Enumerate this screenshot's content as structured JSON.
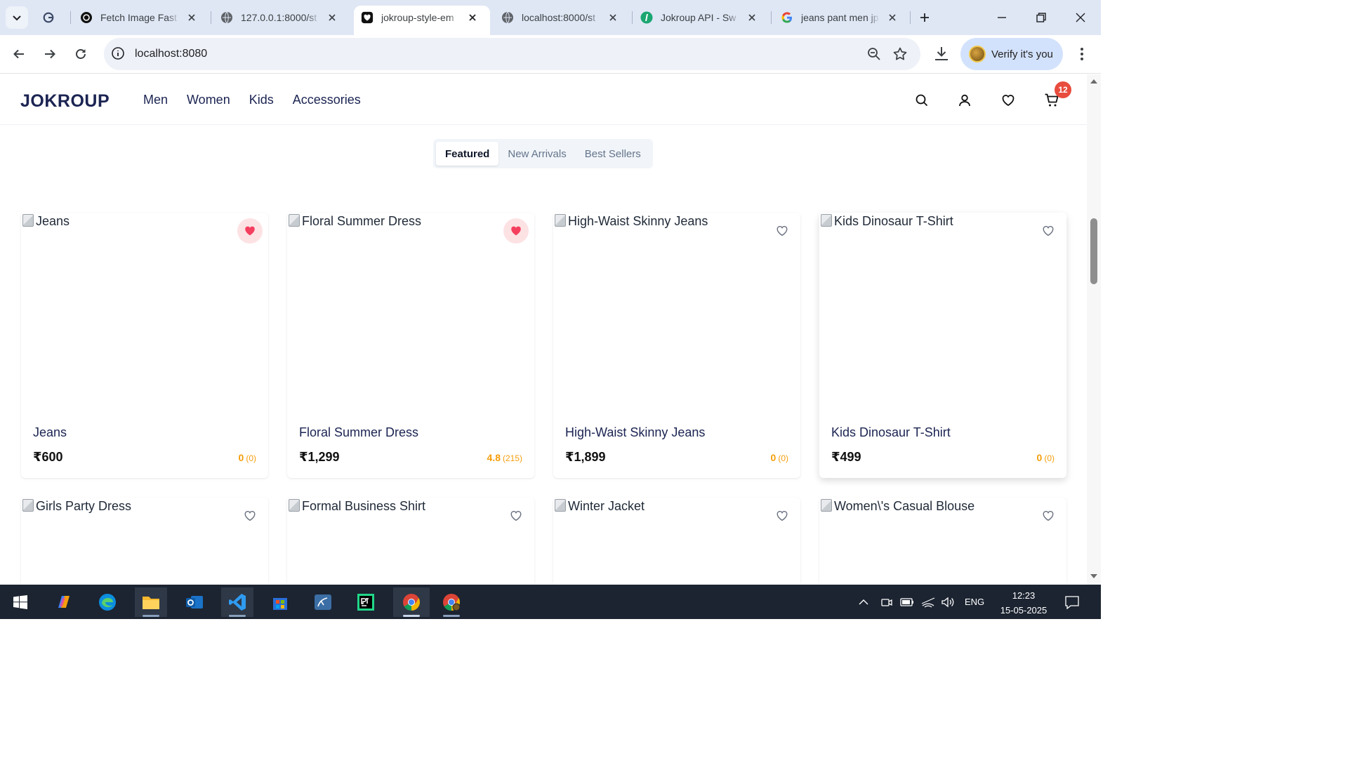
{
  "browser": {
    "tabs": [
      {
        "title": "Fetch Image Fast",
        "icon": "openai-icon"
      },
      {
        "title": "127.0.0.1:8000/st",
        "icon": "globe-icon"
      },
      {
        "title": "jokroup-style-em",
        "icon": "heart-favicon",
        "active": true
      },
      {
        "title": "localhost:8000/st",
        "icon": "globe-icon"
      },
      {
        "title": "Jokroup API - Sw",
        "icon": "swagger-icon"
      },
      {
        "title": "jeans pant men jp",
        "icon": "google-icon"
      }
    ],
    "url": "localhost:8080",
    "profile_label": "Verify it's you"
  },
  "site": {
    "logo": "JOKROUP",
    "nav": [
      "Men",
      "Women",
      "Kids",
      "Accessories"
    ],
    "cart_count": "12"
  },
  "filters": {
    "options": [
      "Featured",
      "New Arrivals",
      "Best Sellers"
    ],
    "selected": "Featured"
  },
  "products": [
    {
      "alt": "Jeans",
      "name": "Jeans",
      "price": "₹600",
      "rating": "0",
      "reviews": "(0)",
      "favorited": true
    },
    {
      "alt": "Floral Summer Dress",
      "name": "Floral Summer Dress",
      "price": "₹1,299",
      "rating": "4.8",
      "reviews": "(215)",
      "favorited": true
    },
    {
      "alt": "High-Waist Skinny Jeans",
      "name": "High-Waist Skinny Jeans",
      "price": "₹1,899",
      "rating": "0",
      "reviews": "(0)",
      "favorited": false
    },
    {
      "alt": "Kids Dinosaur T-Shirt",
      "name": "Kids Dinosaur T-Shirt",
      "price": "₹499",
      "rating": "0",
      "reviews": "(0)",
      "favorited": false
    },
    {
      "alt": "Girls Party Dress",
      "favorited": false
    },
    {
      "alt": "Formal Business Shirt",
      "favorited": false
    },
    {
      "alt": "Winter Jacket",
      "favorited": false
    },
    {
      "alt": "Women\\'s Casual Blouse",
      "favorited": false
    }
  ],
  "taskbar": {
    "apps": [
      "windows-start-icon",
      "copilot-icon",
      "edge-icon",
      "file-explorer-icon",
      "outlook-icon",
      "vscode-icon",
      "store-icon",
      "mysql-workbench-icon",
      "pycharm-icon",
      "chrome-icon",
      "chrome-profile-icon"
    ],
    "language": "ENG",
    "time": "12:23",
    "date": "15-05-2025"
  },
  "colors": {
    "brand": "#1b2452",
    "favorite": "#f43f5e",
    "rating": "#f59e0b",
    "cart_badge": "#e84c3d"
  }
}
